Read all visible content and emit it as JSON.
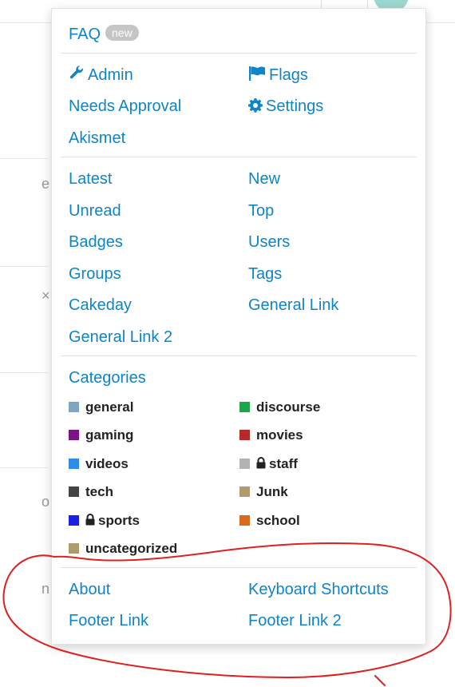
{
  "faq": {
    "label": "FAQ",
    "badge": "new"
  },
  "admin_links": [
    {
      "label": "Admin",
      "icon": "wrench-icon"
    },
    {
      "label": "Flags",
      "icon": "flag-icon"
    },
    {
      "label": "Needs Approval"
    },
    {
      "label": "Settings",
      "icon": "gear-icon"
    },
    {
      "label": "Akismet"
    }
  ],
  "nav_links": [
    "Latest",
    "New",
    "Unread",
    "Top",
    "Badges",
    "Users",
    "Groups",
    "Tags",
    "Cakeday",
    "General Link",
    "General Link 2"
  ],
  "categories": {
    "heading": "Categories",
    "items": [
      {
        "name": "general",
        "color": "#7ea6c3",
        "locked": false
      },
      {
        "name": "discourse",
        "color": "#1aa64a",
        "locked": false
      },
      {
        "name": "gaming",
        "color": "#7d1483",
        "locked": false
      },
      {
        "name": "movies",
        "color": "#b52a28",
        "locked": false
      },
      {
        "name": "videos",
        "color": "#2d8ce6",
        "locked": false
      },
      {
        "name": "staff",
        "color": "#b3b3b3",
        "locked": true
      },
      {
        "name": "tech",
        "color": "#444444",
        "locked": false
      },
      {
        "name": "Junk",
        "color": "#b09a6e",
        "locked": false
      },
      {
        "name": "sports",
        "color": "#1a21e6",
        "locked": true
      },
      {
        "name": "school",
        "color": "#dc6a1b",
        "locked": false
      },
      {
        "name": "uncategorized",
        "color": "#ad9a6d",
        "locked": false
      }
    ]
  },
  "footer_links": [
    "About",
    "Keyboard Shortcuts",
    "Footer Link",
    "Footer Link 2"
  ],
  "colors": {
    "link": "#0e84c9",
    "annotation": "#e02020"
  }
}
